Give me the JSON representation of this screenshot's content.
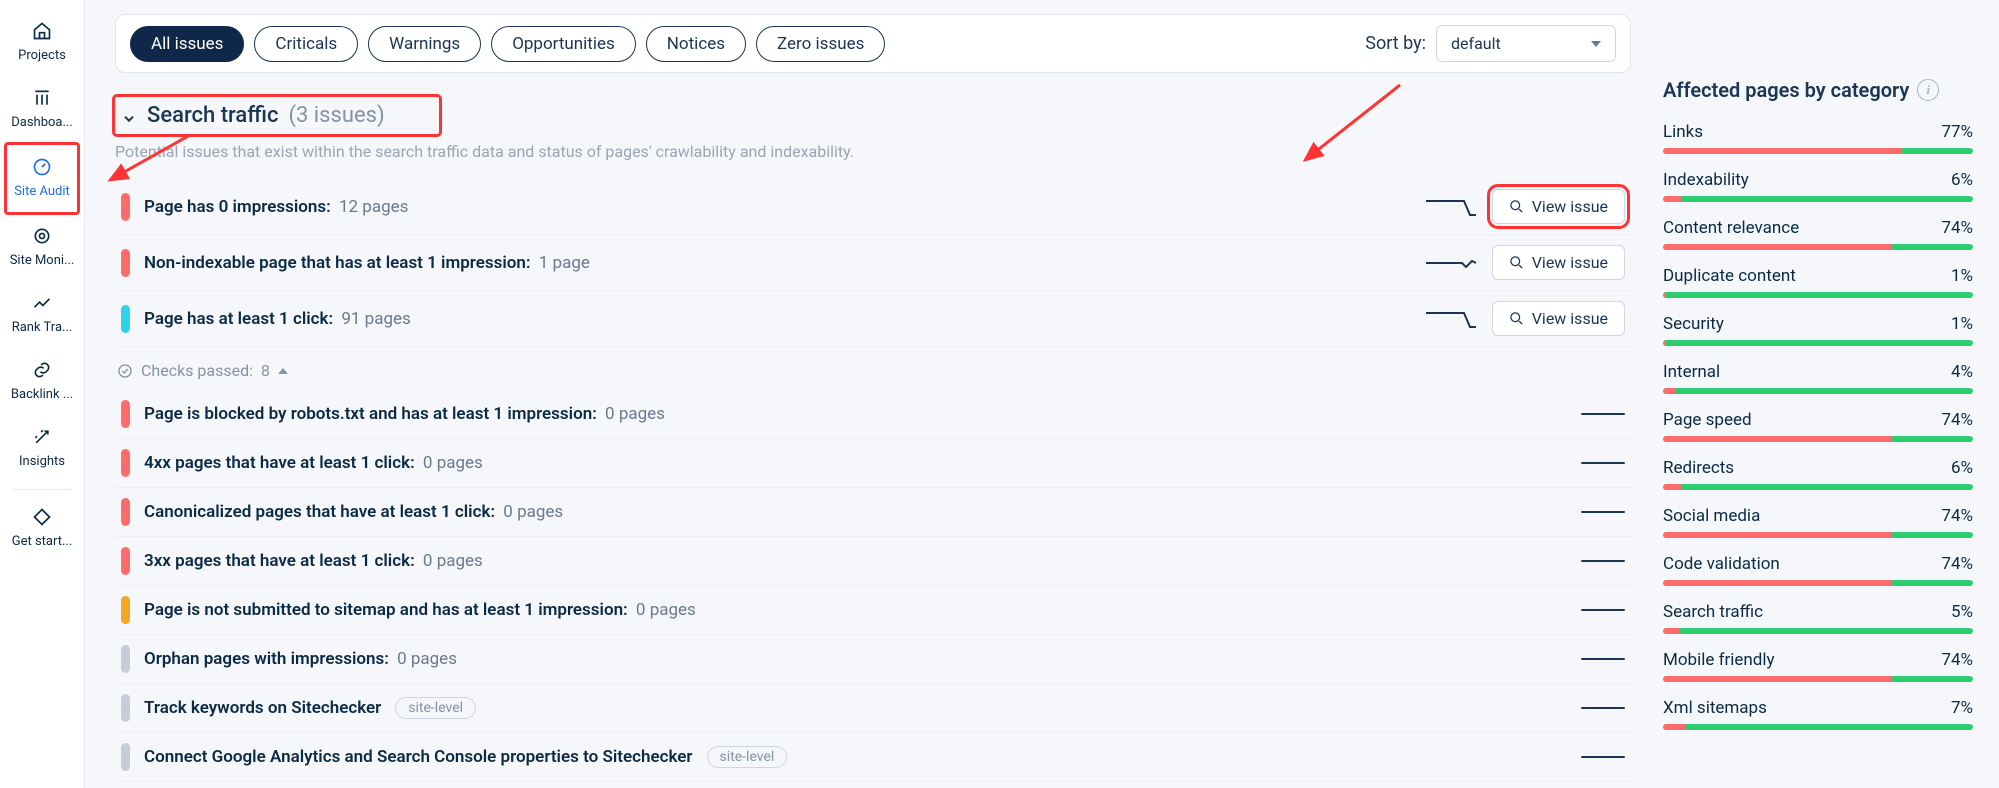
{
  "sidebar": {
    "items": [
      {
        "label": "Projects"
      },
      {
        "label": "Dashboa..."
      },
      {
        "label": "Site Audit"
      },
      {
        "label": "Site Moni..."
      },
      {
        "label": "Rank Tra..."
      },
      {
        "label": "Backlink ..."
      },
      {
        "label": "Insights"
      },
      {
        "label": "Get start..."
      }
    ]
  },
  "filter": {
    "pills": [
      "All issues",
      "Criticals",
      "Warnings",
      "Opportunities",
      "Notices",
      "Zero issues"
    ],
    "sort_label": "Sort by:",
    "sort_value": "default"
  },
  "section": {
    "title": "Search traffic",
    "count_text": "(3 issues)",
    "subtitle": "Potential issues that exist within the search traffic data and status of pages' crawlability and indexability."
  },
  "issues_active": [
    {
      "sev": "red",
      "name": "Page has 0 impressions:",
      "val": "12 pages",
      "spark": "drop",
      "view": "View issue"
    },
    {
      "sev": "red",
      "name": "Non-indexable page that has at least 1 impression:",
      "val": "1 page",
      "spark": "flat",
      "view": "View issue"
    },
    {
      "sev": "cyan",
      "name": "Page has at least 1 click:",
      "val": "91 pages",
      "spark": "drop",
      "view": "View issue"
    }
  ],
  "checks_passed": {
    "prefix": "Checks passed:",
    "count": "8"
  },
  "issues_passed": [
    {
      "sev": "red",
      "name": "Page is blocked by robots.txt and has at least 1 impression:",
      "val": "0 pages"
    },
    {
      "sev": "red",
      "name": "4xx pages that have at least 1 click:",
      "val": "0 pages"
    },
    {
      "sev": "red",
      "name": "Canonicalized pages that have at least 1 click:",
      "val": "0 pages"
    },
    {
      "sev": "red",
      "name": "3xx pages that have at least 1 click:",
      "val": "0 pages"
    },
    {
      "sev": "orange",
      "name": "Page is not submitted to sitemap and has at least 1 impression:",
      "val": "0 pages"
    },
    {
      "sev": "gray",
      "name": "Orphan pages with impressions:",
      "val": "0 pages"
    },
    {
      "sev": "gray",
      "name": "Track keywords on Sitechecker",
      "site": true
    },
    {
      "sev": "gray",
      "name": "Connect Google Analytics and Search Console properties to Sitechecker",
      "site": true
    }
  ],
  "site_level_label": "site-level",
  "affected": {
    "title": "Affected pages by category",
    "categories": [
      {
        "name": "Links",
        "pct": "77%",
        "red": 77
      },
      {
        "name": "Indexability",
        "pct": "6%",
        "red": 6
      },
      {
        "name": "Content relevance",
        "pct": "74%",
        "red": 74
      },
      {
        "name": "Duplicate content",
        "pct": "1%",
        "red": 1
      },
      {
        "name": "Security",
        "pct": "1%",
        "red": 1
      },
      {
        "name": "Internal",
        "pct": "4%",
        "red": 4
      },
      {
        "name": "Page speed",
        "pct": "74%",
        "red": 74
      },
      {
        "name": "Redirects",
        "pct": "6%",
        "red": 6
      },
      {
        "name": "Social media",
        "pct": "74%",
        "red": 74
      },
      {
        "name": "Code validation",
        "pct": "74%",
        "red": 74
      },
      {
        "name": "Search traffic",
        "pct": "5%",
        "red": 5
      },
      {
        "name": "Mobile friendly",
        "pct": "74%",
        "red": 74
      },
      {
        "name": "Xml sitemaps",
        "pct": "7%",
        "red": 7
      }
    ]
  }
}
